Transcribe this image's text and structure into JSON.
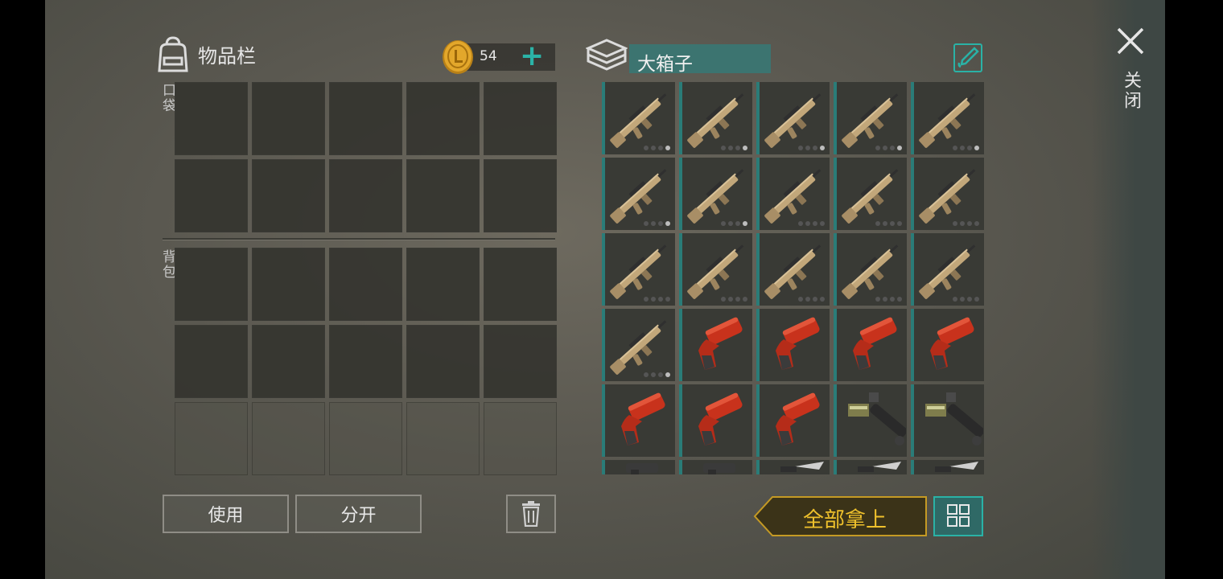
{
  "inventory": {
    "title": "物品栏",
    "coins": "54",
    "coin_add": "+",
    "pocket_label": "口袋",
    "backpack_label": "背包",
    "use_button": "使用",
    "split_button": "分开"
  },
  "box": {
    "name": "大箱子",
    "take_all_button": "全部拿上",
    "items": [
      {
        "type": "rifle",
        "durability": 1,
        "max": 4
      },
      {
        "type": "rifle",
        "durability": 1,
        "max": 4
      },
      {
        "type": "rifle",
        "durability": 1,
        "max": 4
      },
      {
        "type": "rifle",
        "durability": 1,
        "max": 4
      },
      {
        "type": "rifle",
        "durability": 1,
        "max": 4
      },
      {
        "type": "rifle",
        "durability": 1,
        "max": 4
      },
      {
        "type": "rifle",
        "durability": 1,
        "max": 4
      },
      {
        "type": "rifle",
        "durability": 0,
        "max": 4
      },
      {
        "type": "rifle",
        "durability": 0,
        "max": 4
      },
      {
        "type": "rifle",
        "durability": 0,
        "max": 4
      },
      {
        "type": "rifle",
        "durability": 0,
        "max": 4
      },
      {
        "type": "rifle",
        "durability": 0,
        "max": 4
      },
      {
        "type": "rifle",
        "durability": 0,
        "max": 4
      },
      {
        "type": "rifle",
        "durability": 0,
        "max": 4
      },
      {
        "type": "rifle",
        "durability": 0,
        "max": 4
      },
      {
        "type": "rifle",
        "durability": 1,
        "max": 4
      },
      {
        "type": "flare_gun"
      },
      {
        "type": "flare_gun"
      },
      {
        "type": "flare_gun"
      },
      {
        "type": "flare_gun"
      },
      {
        "type": "flare_gun"
      },
      {
        "type": "flare_gun"
      },
      {
        "type": "flare_gun"
      },
      {
        "type": "launcher"
      },
      {
        "type": "launcher"
      },
      {
        "type": "pistol"
      },
      {
        "type": "pistol"
      },
      {
        "type": "knife"
      },
      {
        "type": "knife"
      },
      {
        "type": "knife"
      }
    ]
  },
  "close_label": "关闭",
  "colors": {
    "accent_teal": "#2ab2a6",
    "gold": "#efc12c",
    "slot_bg": "#34342f"
  },
  "icons": {
    "bag": "backpack-icon",
    "coin": "coin-icon",
    "box": "box-stack-icon",
    "edit": "edit-brush-icon",
    "trash": "trash-icon",
    "layout": "grid-layout-icon",
    "close": "close-icon"
  }
}
